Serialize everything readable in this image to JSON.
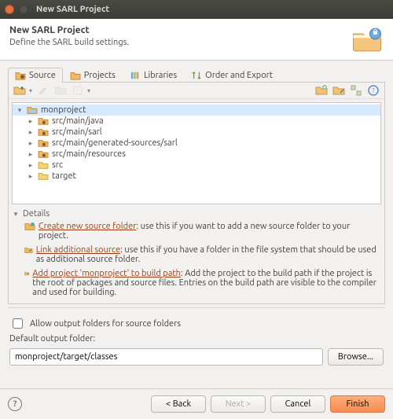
{
  "window": {
    "title": "New SARL Project"
  },
  "header": {
    "title": "New SARL Project",
    "subtitle": "Define the SARL build settings."
  },
  "tabs": {
    "source": "Source",
    "projects": "Projects",
    "libraries": "Libraries",
    "order": "Order and Export"
  },
  "tree": {
    "root": "monproject",
    "nodes": [
      "src/main/java",
      "src/main/sarl",
      "src/main/generated-sources/sarl",
      "src/main/resources",
      "src",
      "target"
    ]
  },
  "details": {
    "heading": "Details",
    "create": {
      "link": "Create new source folder",
      "text": ": use this if you want to add a new source folder to your project."
    },
    "link": {
      "link": "Link additional source",
      "text": ": use this if you have a folder in the file system that should be used as additional source folder."
    },
    "add": {
      "link": "Add project 'monproject' to build path",
      "text": ": Add the project to the build path if the project is the root of packages and source files. Entries on the build path are visible to the compiler and used for building."
    }
  },
  "output": {
    "allow_label": "Allow output folders for source folders",
    "default_label": "Default output folder:",
    "path": "monproject/target/classes",
    "browse": "Browse..."
  },
  "footer": {
    "back": "< Back",
    "next": "Next >",
    "cancel": "Cancel",
    "finish": "Finish"
  },
  "icons": {
    "folder": "folder-icon"
  }
}
